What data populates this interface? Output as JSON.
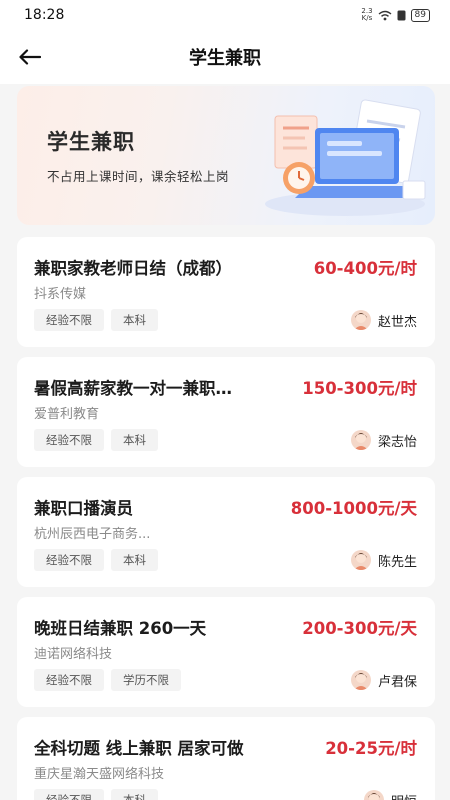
{
  "status_bar": {
    "time": "18:28",
    "net_speed_top": "2.3",
    "net_speed_bottom": "K/s",
    "battery": "89"
  },
  "nav": {
    "title": "学生兼职"
  },
  "banner": {
    "title": "学生兼职",
    "subtitle": "不占用上课时间，课余轻松上岗"
  },
  "colors": {
    "salary": "#d8303a",
    "background": "#f5f5f5"
  },
  "jobs": [
    {
      "title": "兼职家教老师日结（成都）",
      "salary": "60-400元/时",
      "company": "抖系传媒",
      "tags": [
        "经验不限",
        "本科"
      ],
      "recruiter": "赵世杰"
    },
    {
      "title": "暑假高薪家教一对一兼职…",
      "salary": "150-300元/时",
      "company": "爱普利教育",
      "tags": [
        "经验不限",
        "本科"
      ],
      "recruiter": "梁志怡"
    },
    {
      "title": "兼职口播演员",
      "salary": "800-1000元/天",
      "company": "杭州辰西电子商务...",
      "tags": [
        "经验不限",
        "本科"
      ],
      "recruiter": "陈先生"
    },
    {
      "title": "晚班日结兼职 260一天",
      "salary": "200-300元/天",
      "company": "迪诺网络科技",
      "tags": [
        "经验不限",
        "学历不限"
      ],
      "recruiter": "卢君保"
    },
    {
      "title": "全科切题 线上兼职 居家可做",
      "salary": "20-25元/时",
      "company": "重庆星瀚天盛网络科技",
      "tags": [
        "经验不限",
        "本科"
      ],
      "recruiter": "明恒"
    }
  ]
}
